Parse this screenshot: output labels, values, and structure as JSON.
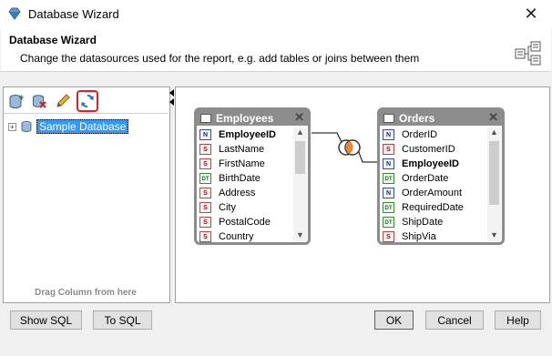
{
  "window": {
    "title": "Database Wizard",
    "close_glyph": "✕"
  },
  "header": {
    "title": "Database Wizard",
    "description": "Change the datasources used for the report, e.g. add tables or joins between them"
  },
  "toolbar": {
    "icons": [
      "add-datasource-icon",
      "delete-icon",
      "edit-icon",
      "refresh-icon"
    ]
  },
  "tree": {
    "expander": "+",
    "label": "Sample Database"
  },
  "drag_hint": "Drag Column from here",
  "tables": [
    {
      "title": "Employees",
      "close_glyph": "✕",
      "columns": [
        {
          "type": "N",
          "name": "EmployeeID",
          "key": true
        },
        {
          "type": "S",
          "name": "LastName",
          "key": false
        },
        {
          "type": "S",
          "name": "FirstName",
          "key": false
        },
        {
          "type": "DT",
          "name": "BirthDate",
          "key": false
        },
        {
          "type": "S",
          "name": "Address",
          "key": false
        },
        {
          "type": "S",
          "name": "City",
          "key": false
        },
        {
          "type": "S",
          "name": "PostalCode",
          "key": false
        },
        {
          "type": "S",
          "name": "Country",
          "key": false
        }
      ]
    },
    {
      "title": "Orders",
      "close_glyph": "✕",
      "columns": [
        {
          "type": "N",
          "name": "OrderID",
          "key": false
        },
        {
          "type": "S",
          "name": "CustomerID",
          "key": false
        },
        {
          "type": "N",
          "name": "EmployeeID",
          "key": true
        },
        {
          "type": "DT",
          "name": "OrderDate",
          "key": false
        },
        {
          "type": "N",
          "name": "OrderAmount",
          "key": false
        },
        {
          "type": "DT",
          "name": "RequiredDate",
          "key": false
        },
        {
          "type": "DT",
          "name": "ShipDate",
          "key": false
        },
        {
          "type": "S",
          "name": "ShipVia",
          "key": false
        }
      ]
    }
  ],
  "scroll_arrows": {
    "up": "▲",
    "down": "▼"
  },
  "buttons": {
    "show_sql": "Show SQL",
    "to_sql": "To SQL",
    "ok": "OK",
    "cancel": "Cancel",
    "help": "Help"
  },
  "colors": {
    "accent": "#0078d7",
    "selection": "#3399ff",
    "highlight_border": "#e41e26",
    "table_header": "#8c8c8c"
  }
}
